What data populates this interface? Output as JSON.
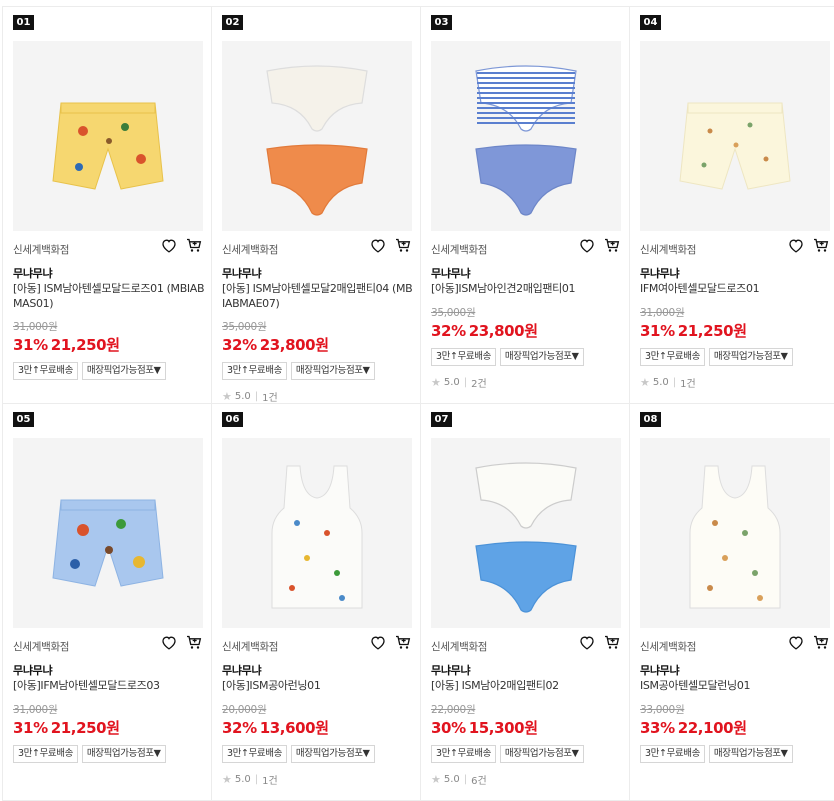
{
  "products": [
    {
      "rank": "01",
      "store": "신세계백화점",
      "brand": "무냐무냐",
      "title": "[아동] ISM남아텐셀모달드로즈01 (MBIABMAS01)",
      "orig": "31,000원",
      "rate": "31%",
      "price": "21,250원",
      "tags": [
        "3만↑무료배송",
        "매장픽업가능점포▼"
      ],
      "rating": "",
      "reviews": "",
      "image": "boy-shorts-yellow"
    },
    {
      "rank": "02",
      "store": "신세계백화점",
      "brand": "무냐무냐",
      "title": "[아동] ISM남아텐셀모달2매입팬티04 (MBIABMAE07)",
      "orig": "35,000원",
      "rate": "32%",
      "price": "23,800원",
      "tags": [
        "3만↑무료배송",
        "매장픽업가능점포▼"
      ],
      "rating": "5.0",
      "reviews": "1건",
      "image": "briefs-2pack-white-orange"
    },
    {
      "rank": "03",
      "store": "신세계백화점",
      "brand": "무냐무냐",
      "title": "[아동]ISM남아인견2매입팬티01",
      "orig": "35,000원",
      "rate": "32%",
      "price": "23,800원",
      "tags": [
        "3만↑무료배송",
        "매장픽업가능점포▼"
      ],
      "rating": "5.0",
      "reviews": "2건",
      "image": "briefs-2pack-blue-stripe"
    },
    {
      "rank": "04",
      "store": "신세계백화점",
      "brand": "무냐무냐",
      "title": "IFM여아텐셀모달드로즈01",
      "orig": "31,000원",
      "rate": "31%",
      "price": "21,250원",
      "tags": [
        "3만↑무료배송",
        "매장픽업가능점포▼"
      ],
      "rating": "5.0",
      "reviews": "1건",
      "image": "girl-shorts-cream"
    },
    {
      "rank": "05",
      "store": "신세계백화점",
      "brand": "무냐무냐",
      "title": "[아동]IFM남아텐셀모달드로즈03",
      "orig": "31,000원",
      "rate": "31%",
      "price": "21,250원",
      "tags": [
        "3만↑무료배송",
        "매장픽업가능점포▼"
      ],
      "rating": "",
      "reviews": "",
      "image": "boy-shorts-blue"
    },
    {
      "rank": "06",
      "store": "신세계백화점",
      "brand": "무냐무냐",
      "title": "[아동]ISM공아런닝01",
      "orig": "20,000원",
      "rate": "32%",
      "price": "13,600원",
      "tags": [
        "3만↑무료배송",
        "매장픽업가능점포▼"
      ],
      "rating": "5.0",
      "reviews": "1건",
      "image": "tank-top-white"
    },
    {
      "rank": "07",
      "store": "신세계백화점",
      "brand": "무냐무냐",
      "title": "[아동] ISM남아2매입팬티02",
      "orig": "22,000원",
      "rate": "30%",
      "price": "15,300원",
      "tags": [
        "3만↑무료배송",
        "매장픽업가능점포▼"
      ],
      "rating": "5.0",
      "reviews": "6건",
      "image": "briefs-2pack-white-blue"
    },
    {
      "rank": "08",
      "store": "신세계백화점",
      "brand": "무냐무냐",
      "title": "ISM공아텐셀모달런닝01",
      "orig": "33,000원",
      "rate": "33%",
      "price": "22,100원",
      "tags": [
        "3만↑무료배송",
        "매장픽업가능점포▼"
      ],
      "rating": "",
      "reviews": "",
      "image": "tank-top-cream"
    }
  ],
  "colors": {
    "price_red": "#e1141f",
    "rank_bg": "#111111",
    "thumb_bg": "#f4f4f4"
  },
  "icons": {
    "wishlist": "heart-icon",
    "cart": "cart-icon",
    "star": "star-icon"
  }
}
